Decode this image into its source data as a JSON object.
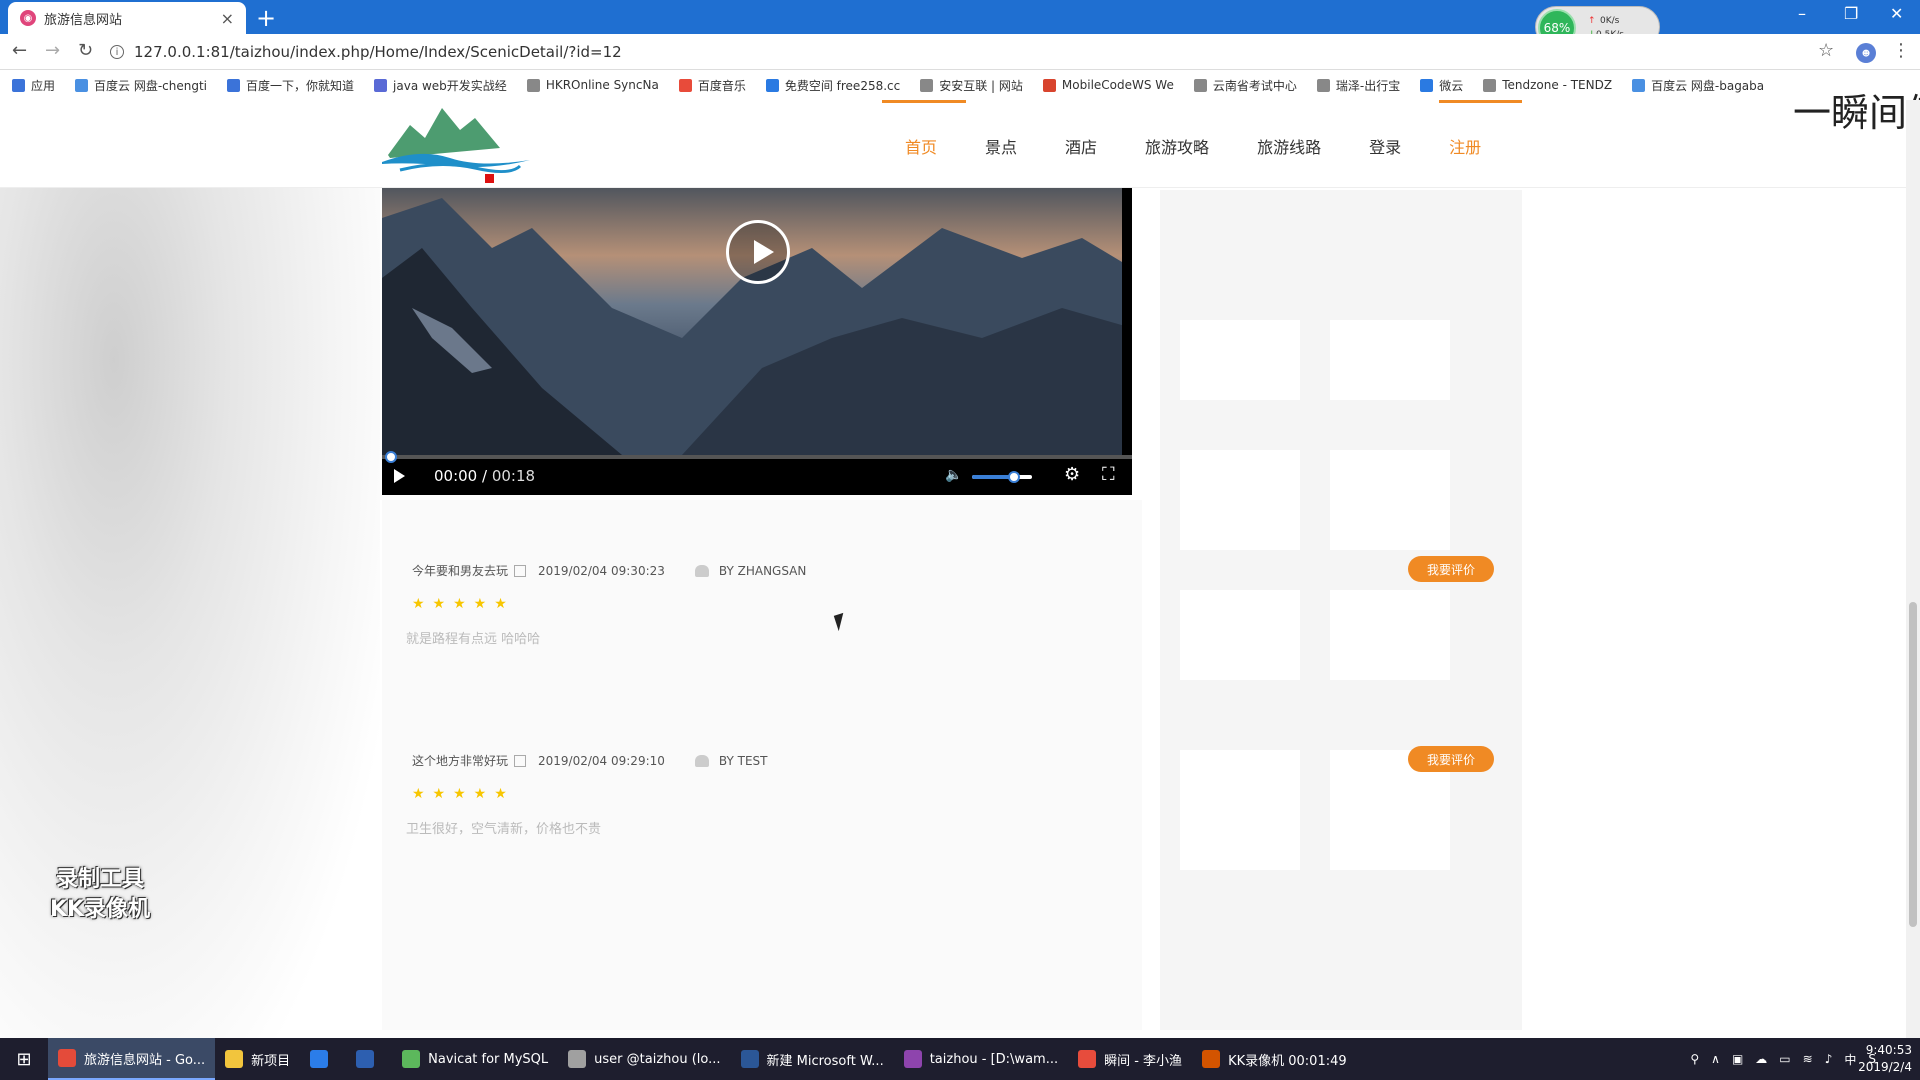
{
  "browser": {
    "tab_title": "旅游信息网站",
    "tab_icon": "site-favicon",
    "tab_close": "×",
    "new_tab": "+",
    "url": "127.0.0.1:81/taizhou/index.php/Home/Index/ScenicDetail/?id=12",
    "window_controls": {
      "minimize": "–",
      "restore": "❐",
      "close": "✕"
    }
  },
  "net_widget": {
    "percent": "68%",
    "up": "0K/s",
    "down": "0.5K/s"
  },
  "bookmarks": [
    {
      "label": "应用",
      "color": "#3b73d9"
    },
    {
      "label": "百度云 网盘-chengti",
      "color": "#4a90e2"
    },
    {
      "label": "百度一下，你就知道",
      "color": "#3b73d9"
    },
    {
      "label": "java web开发实战经",
      "color": "#5a6ad6"
    },
    {
      "label": "HKROnline SyncNa",
      "color": "#888888"
    },
    {
      "label": "百度音乐",
      "color": "#e84b3a"
    },
    {
      "label": "免费空间 free258.cc",
      "color": "#2a7ae2"
    },
    {
      "label": "安安互联 | 网站",
      "color": "#888888"
    },
    {
      "label": "MobileCodeWS We",
      "color": "#d8442e"
    },
    {
      "label": "云南省考试中心",
      "color": "#888888"
    },
    {
      "label": "瑞泽-出行宝",
      "color": "#888888"
    },
    {
      "label": "微云",
      "color": "#2a7ae2"
    },
    {
      "label": "Tendzone - TENDZ",
      "color": "#888888"
    },
    {
      "label": "百度云 网盘-bagaba",
      "color": "#4a90e2"
    }
  ],
  "site": {
    "nav": [
      {
        "label": "首页",
        "state": "active"
      },
      {
        "label": "景点",
        "state": ""
      },
      {
        "label": "酒店",
        "state": ""
      },
      {
        "label": "旅游攻略",
        "state": ""
      },
      {
        "label": "旅游线路",
        "state": ""
      },
      {
        "label": "登录",
        "state": ""
      },
      {
        "label": "注册",
        "state": "accent"
      }
    ],
    "accent_color": "#f08a24"
  },
  "video": {
    "current_time": "00:00",
    "duration": "00:18",
    "progress": 0,
    "volume": 0.7
  },
  "comments": [
    {
      "title": "今年要和男友去玩",
      "date": "2019/02/04 09:30:23",
      "author": "BY ZHANGSAN",
      "rating": 5,
      "stars": "★★★★★",
      "text": "就是路程有点远 哈哈哈",
      "button": "我要评价"
    },
    {
      "title": "这个地方非常好玩",
      "date": "2019/02/04 09:29:10",
      "author": "BY TEST",
      "rating": 5,
      "stars": "★★★★★",
      "text": "卫生很好，空气清新，价格也不贵",
      "button": "我要评价"
    }
  ],
  "watermark": {
    "line1": "录制工具",
    "line2": "KK录像机"
  },
  "overlay_text": "一瞬间倾",
  "taskbar": {
    "start_icon": "windows-icon",
    "items": [
      {
        "label": "旅游信息网站 - Go...",
        "color": "#e44b3a",
        "active": true
      },
      {
        "label": "新项目",
        "color": "#f2c53d",
        "active": false
      },
      {
        "label": "",
        "color": "#2b7de9",
        "active": false
      },
      {
        "label": "",
        "color": "#2d5fb0",
        "active": false
      },
      {
        "label": "Navicat for MySQL",
        "color": "#5cb85c",
        "active": false
      },
      {
        "label": "user @taizhou (lo...",
        "color": "#a0a0a0",
        "active": false
      },
      {
        "label": "新建 Microsoft W...",
        "color": "#2b5797",
        "active": false
      },
      {
        "label": "taizhou - [D:\\wam...",
        "color": "#8e44ad",
        "active": false
      },
      {
        "label": "瞬间 - 李小渔",
        "color": "#e74c3c",
        "active": false
      },
      {
        "label": "KK录像机 00:01:49",
        "color": "#d35400",
        "active": false
      }
    ],
    "tray": [
      "⚲",
      "∧",
      "▣",
      "☁",
      "▭",
      "≋",
      "♪",
      "中",
      "S"
    ],
    "time": "9:40:53",
    "date": "2019/2/4"
  }
}
